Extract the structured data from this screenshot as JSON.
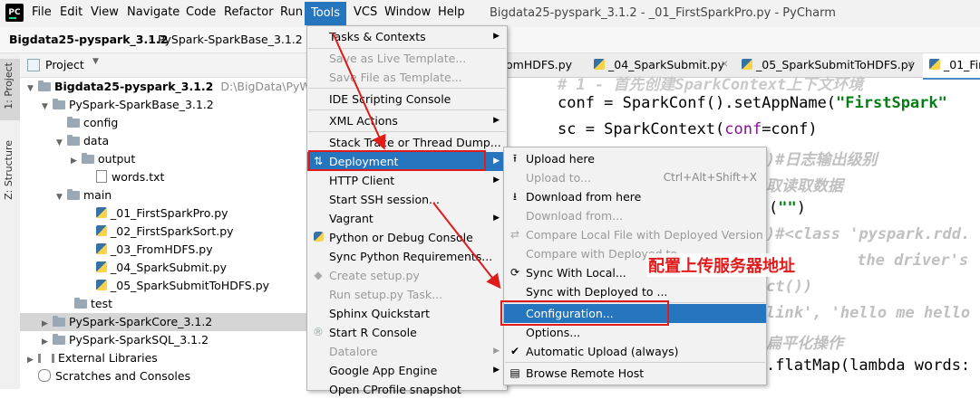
{
  "menubar": {
    "logo": "PC",
    "items": [
      "File",
      "Edit",
      "View",
      "Navigate",
      "Code",
      "Refactor",
      "Run",
      "Tools",
      "VCS",
      "Window",
      "Help"
    ],
    "window_title": "Bigdata25-pyspark_3.1.2 - _01_FirstSparkPro.py - PyCharm"
  },
  "breadcrumb": [
    "Bigdata25-pyspark_3.1.2",
    "PySpark-SparkBase_3.1.2"
  ],
  "side_tabs": [
    "1: Project",
    "Z: Structure"
  ],
  "project": {
    "header": "Project",
    "root": "Bigdata25-pyspark_3.1.2",
    "root_path": "D:\\BigData\\PyWorksp",
    "nodes": [
      {
        "label": "PySpark-SparkBase_3.1.2",
        "kind": "folder"
      },
      {
        "label": "config",
        "kind": "folder"
      },
      {
        "label": "data",
        "kind": "folder"
      },
      {
        "label": "output",
        "kind": "folder"
      },
      {
        "label": "words.txt",
        "kind": "text"
      },
      {
        "label": "main",
        "kind": "folder"
      },
      {
        "label": "_01_FirstSparkPro.py",
        "kind": "py"
      },
      {
        "label": "_02_FirstSparkSort.py",
        "kind": "py"
      },
      {
        "label": "_03_FromHDFS.py",
        "kind": "py"
      },
      {
        "label": "_04_SparkSubmit.py",
        "kind": "py"
      },
      {
        "label": "_05_SparkSubmitToHDFS.py",
        "kind": "py"
      },
      {
        "label": "test",
        "kind": "folder"
      },
      {
        "label": "PySpark-SparkCore_3.1.2",
        "kind": "folder"
      },
      {
        "label": "PySpark-SparkSQL_3.1.2",
        "kind": "folder"
      },
      {
        "label": "External Libraries",
        "kind": "lib"
      },
      {
        "label": "Scratches and Consoles",
        "kind": "scratch"
      }
    ]
  },
  "editor": {
    "tabs": [
      "omHDFS.py",
      "_04_SparkSubmit.py",
      "_05_SparkSubmitToHDFS.py",
      "_01_Firs"
    ],
    "lines": {
      "l1": "# 1 - 首先创建SparkContext上下文环境",
      "l2a": "conf = SparkConf().setAppName(",
      "l2s": "\"FirstSpark\"",
      "l3a": "sc = SparkContext(",
      "l3k": "conf",
      "l3b": "=conf)",
      "l4": ")#日志输出级别",
      "l5": "取读取数据",
      "l6a": "(",
      "l6s": "\"\"",
      "l6b": ")",
      "l7": ")#<class 'pyspark.rdd.",
      "l8": " the driver's",
      "l9": "ct())",
      "l10": "link', 'hello me hello",
      "l11": "扁平化操作",
      "l12": ".flatMap(lambda words:"
    }
  },
  "tools_menu": {
    "items": [
      {
        "label": "Tasks & Contexts",
        "sub": true
      },
      {
        "label": "Save as Live Template...",
        "disabled": true
      },
      {
        "label": "Save File as Template...",
        "disabled": true
      },
      {
        "label": "IDE Scripting Console"
      },
      {
        "label": "XML Actions",
        "sub": true
      },
      {
        "label": "Stack Trace or Thread Dump..."
      },
      {
        "label": "Deployment",
        "sub": true,
        "selected": true
      },
      {
        "label": "HTTP Client",
        "sub": true
      },
      {
        "label": "Start SSH session..."
      },
      {
        "label": "Vagrant",
        "sub": true
      },
      {
        "label": "Python or Debug Console"
      },
      {
        "label": "Sync Python Requirements..."
      },
      {
        "label": "Create setup.py",
        "disabled": true
      },
      {
        "label": "Run setup.py Task...",
        "disabled": true
      },
      {
        "label": "Sphinx Quickstart"
      },
      {
        "label": "Start R Console"
      },
      {
        "label": "Datalore",
        "sub": true,
        "disabled": true
      },
      {
        "label": "Google App Engine",
        "sub": true
      },
      {
        "label": "Open CProfile snapshot"
      }
    ]
  },
  "deployment_menu": {
    "items": [
      {
        "label": "Upload here"
      },
      {
        "label": "Upload to...",
        "shortcut": "Ctrl+Alt+Shift+X",
        "disabled": true
      },
      {
        "label": "Download from here"
      },
      {
        "label": "Download from...",
        "disabled": true
      },
      {
        "label": "Compare Local File with Deployed Version",
        "disabled": true
      },
      {
        "label": "Compare with Deployed to",
        "disabled": true
      },
      {
        "label": "Sync With Local..."
      },
      {
        "label": "Sync with Deployed to ..."
      },
      {
        "label": "Configuration...",
        "selected": true
      },
      {
        "label": "Options..."
      },
      {
        "label": "Automatic Upload (always)",
        "checked": true
      },
      {
        "label": "Browse Remote Host"
      }
    ]
  },
  "annotation": "配置上传服务器地址",
  "colors": {
    "selection": "#2675bf",
    "annotation": "#e01b1b",
    "string": "#067d17",
    "comment": "#8c8c8c"
  }
}
